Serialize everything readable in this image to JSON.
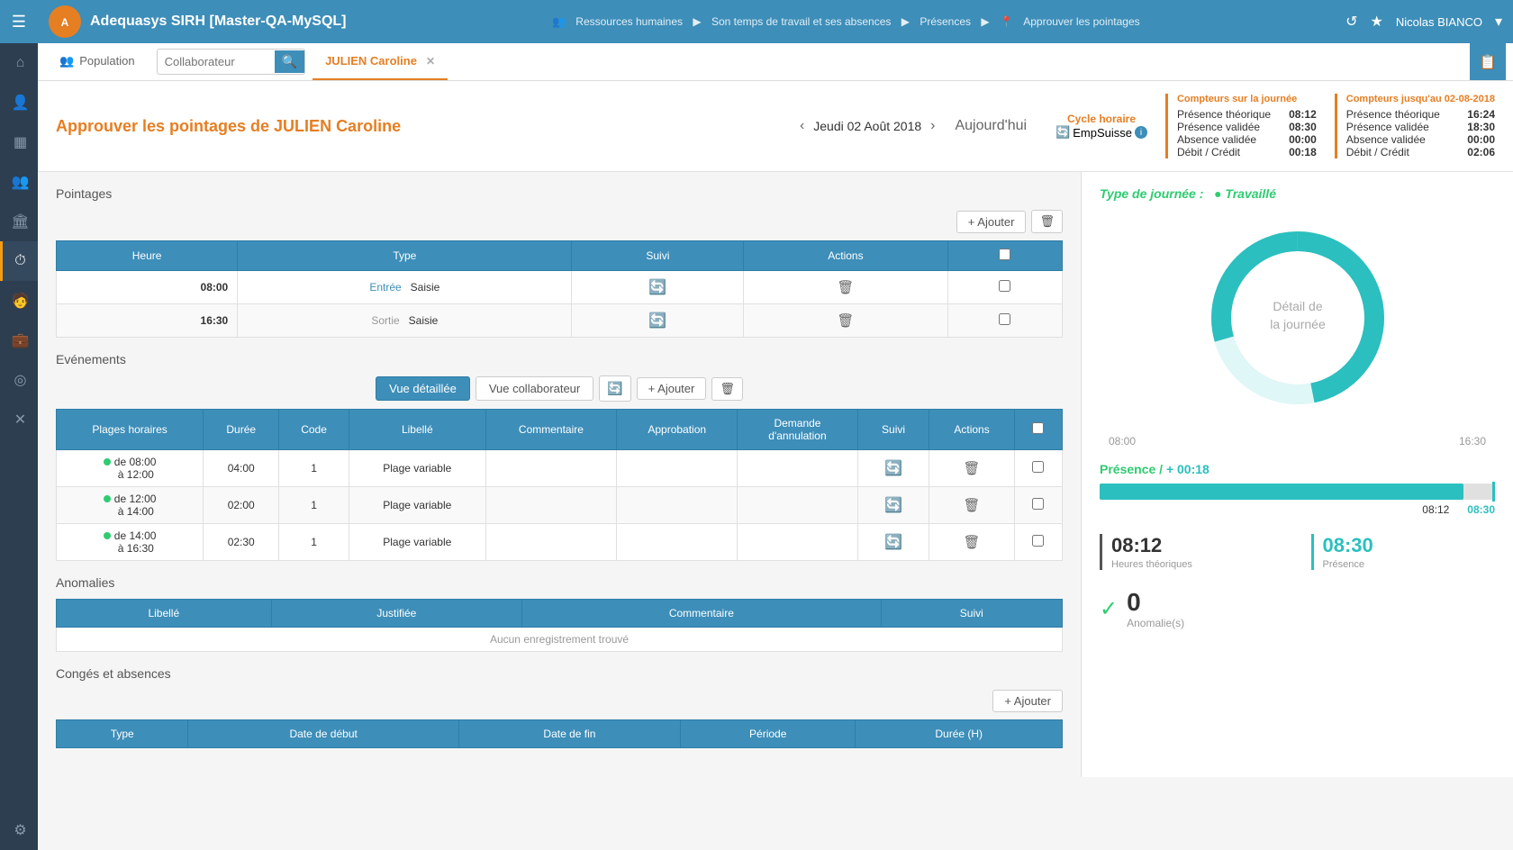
{
  "app": {
    "title": "Adequasys SIRH [Master-QA-MySQL]",
    "logo": "A"
  },
  "breadcrumb": {
    "items": [
      "Ressources humaines",
      "Son temps de travail et ses absences",
      "Présences",
      "Approuver les pointages"
    ]
  },
  "topbar": {
    "user": "Nicolas BIANCO"
  },
  "nav": {
    "population_label": "Population",
    "search_placeholder": "Collaborateur",
    "active_tab": "JULIEN Caroline"
  },
  "page": {
    "title": "Approuver les pointages de JULIEN Caroline",
    "date": "Jeudi 02 Août 2018",
    "today_btn": "Aujourd'hui",
    "cycle": {
      "label": "Cycle horaire",
      "value": "EmpSuisse"
    },
    "counters_day": {
      "label": "Compteurs sur la journée",
      "rows": [
        {
          "label": "Présence théorique",
          "value": "08:12"
        },
        {
          "label": "Présence validée",
          "value": "08:30"
        },
        {
          "label": "Absence validée",
          "value": "00:00"
        },
        {
          "label": "Débit / Crédit",
          "value": "00:18"
        }
      ]
    },
    "counters_total": {
      "label": "Compteurs jusqu'au 02-08-2018",
      "rows": [
        {
          "label": "Présence théorique",
          "value": "16:24"
        },
        {
          "label": "Présence validée",
          "value": "18:30"
        },
        {
          "label": "Absence validée",
          "value": "00:00"
        },
        {
          "label": "Débit / Crédit",
          "value": "02:06"
        }
      ]
    }
  },
  "pointages": {
    "section_title": "Pointages",
    "add_btn": "+ Ajouter",
    "columns": [
      "Heure",
      "Type",
      "Suivi",
      "Actions",
      ""
    ],
    "rows": [
      {
        "heure": "08:00",
        "type_label": "Entrée",
        "type_val": "Saisie"
      },
      {
        "heure": "16:30",
        "type_label": "Sortie",
        "type_val": "Saisie"
      }
    ]
  },
  "evenements": {
    "section_title": "Evénements",
    "btn_vue_detaillee": "Vue détaillée",
    "btn_vue_collaborateur": "Vue collaborateur",
    "add_btn": "+ Ajouter",
    "columns": [
      "Plages horaires",
      "Durée",
      "Code",
      "Libellé",
      "Commentaire",
      "Approbation",
      "Demande d'annulation",
      "Suivi",
      "Actions",
      ""
    ],
    "rows": [
      {
        "plage": "de 08:00\nà 12:00",
        "duree": "04:00",
        "code": "1",
        "libelle": "Plage variable",
        "commentaire": "",
        "approbation": "",
        "demande": ""
      },
      {
        "plage": "de 12:00\nà 14:00",
        "duree": "02:00",
        "code": "1",
        "libelle": "Plage variable",
        "commentaire": "",
        "approbation": "",
        "demande": ""
      },
      {
        "plage": "de 14:00\nà 16:30",
        "duree": "02:30",
        "code": "1",
        "libelle": "Plage variable",
        "commentaire": "",
        "approbation": "",
        "demande": ""
      }
    ]
  },
  "anomalies": {
    "section_title": "Anomalies",
    "columns": [
      "Libellé",
      "Justifiée",
      "Commentaire",
      "Suivi"
    ],
    "empty_message": "Aucun enregistrement trouvé"
  },
  "conges": {
    "section_title": "Congés et absences",
    "add_btn": "+ Ajouter",
    "columns": [
      "Type",
      "Date de début",
      "Date de fin",
      "Période",
      "Durée (H)"
    ]
  },
  "right_panel": {
    "jour_type_label": "Type de journée :",
    "jour_type_value": "Travaillé",
    "donut_center_line1": "Détail de",
    "donut_center_line2": "la journée",
    "presence_label": "Présence /",
    "presence_delta": "+ 00:18",
    "bar_left_label": "08:12",
    "bar_right_label": "08:30",
    "stat_theorique": "08:12",
    "stat_theorique_label": "Heures théoriques",
    "stat_presence": "08:30",
    "stat_presence_label": "Présence",
    "anomalie_count": "0",
    "anomalie_label": "Anomalie(s)",
    "time_start": "08:00",
    "time_end": "16:30"
  },
  "sidebar": {
    "icons": [
      {
        "name": "home-icon",
        "symbol": "⌂"
      },
      {
        "name": "user-icon",
        "symbol": "👤"
      },
      {
        "name": "grid-icon",
        "symbol": "▦"
      },
      {
        "name": "people-icon",
        "symbol": "👥"
      },
      {
        "name": "building-icon",
        "symbol": "🏢"
      },
      {
        "name": "clock-active-icon",
        "symbol": "⏱"
      },
      {
        "name": "person-icon",
        "symbol": "🧑"
      },
      {
        "name": "briefcase-icon",
        "symbol": "💼"
      },
      {
        "name": "refresh-icon",
        "symbol": "↻"
      },
      {
        "name": "tools-icon",
        "symbol": "✕"
      },
      {
        "name": "settings-icon",
        "symbol": "⚙"
      }
    ]
  }
}
